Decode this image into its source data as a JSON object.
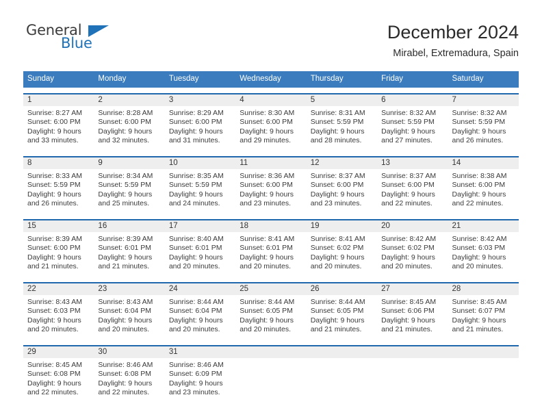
{
  "brand": {
    "word_one": "General",
    "word_two": "Blue",
    "triangle_icon": "triangle-icon",
    "color_blue": "#1f72b8",
    "color_dark": "#3b3b3b"
  },
  "header": {
    "title": "December 2024",
    "subtitle": "Mirabel, Extremadura, Spain"
  },
  "theme": {
    "header_bg": "#3a7cbe",
    "week_border": "#1f68ad",
    "day_number_bg": "#eeeeee"
  },
  "weekdays": [
    "Sunday",
    "Monday",
    "Tuesday",
    "Wednesday",
    "Thursday",
    "Friday",
    "Saturday"
  ],
  "weeks": [
    {
      "days": [
        {
          "number": "1",
          "sunrise": "Sunrise: 8:27 AM",
          "sunset": "Sunset: 6:00 PM",
          "daylight_1": "Daylight: 9 hours",
          "daylight_2": "and 33 minutes."
        },
        {
          "number": "2",
          "sunrise": "Sunrise: 8:28 AM",
          "sunset": "Sunset: 6:00 PM",
          "daylight_1": "Daylight: 9 hours",
          "daylight_2": "and 32 minutes."
        },
        {
          "number": "3",
          "sunrise": "Sunrise: 8:29 AM",
          "sunset": "Sunset: 6:00 PM",
          "daylight_1": "Daylight: 9 hours",
          "daylight_2": "and 31 minutes."
        },
        {
          "number": "4",
          "sunrise": "Sunrise: 8:30 AM",
          "sunset": "Sunset: 6:00 PM",
          "daylight_1": "Daylight: 9 hours",
          "daylight_2": "and 29 minutes."
        },
        {
          "number": "5",
          "sunrise": "Sunrise: 8:31 AM",
          "sunset": "Sunset: 5:59 PM",
          "daylight_1": "Daylight: 9 hours",
          "daylight_2": "and 28 minutes."
        },
        {
          "number": "6",
          "sunrise": "Sunrise: 8:32 AM",
          "sunset": "Sunset: 5:59 PM",
          "daylight_1": "Daylight: 9 hours",
          "daylight_2": "and 27 minutes."
        },
        {
          "number": "7",
          "sunrise": "Sunrise: 8:32 AM",
          "sunset": "Sunset: 5:59 PM",
          "daylight_1": "Daylight: 9 hours",
          "daylight_2": "and 26 minutes."
        }
      ]
    },
    {
      "days": [
        {
          "number": "8",
          "sunrise": "Sunrise: 8:33 AM",
          "sunset": "Sunset: 5:59 PM",
          "daylight_1": "Daylight: 9 hours",
          "daylight_2": "and 26 minutes."
        },
        {
          "number": "9",
          "sunrise": "Sunrise: 8:34 AM",
          "sunset": "Sunset: 5:59 PM",
          "daylight_1": "Daylight: 9 hours",
          "daylight_2": "and 25 minutes."
        },
        {
          "number": "10",
          "sunrise": "Sunrise: 8:35 AM",
          "sunset": "Sunset: 5:59 PM",
          "daylight_1": "Daylight: 9 hours",
          "daylight_2": "and 24 minutes."
        },
        {
          "number": "11",
          "sunrise": "Sunrise: 8:36 AM",
          "sunset": "Sunset: 6:00 PM",
          "daylight_1": "Daylight: 9 hours",
          "daylight_2": "and 23 minutes."
        },
        {
          "number": "12",
          "sunrise": "Sunrise: 8:37 AM",
          "sunset": "Sunset: 6:00 PM",
          "daylight_1": "Daylight: 9 hours",
          "daylight_2": "and 23 minutes."
        },
        {
          "number": "13",
          "sunrise": "Sunrise: 8:37 AM",
          "sunset": "Sunset: 6:00 PM",
          "daylight_1": "Daylight: 9 hours",
          "daylight_2": "and 22 minutes."
        },
        {
          "number": "14",
          "sunrise": "Sunrise: 8:38 AM",
          "sunset": "Sunset: 6:00 PM",
          "daylight_1": "Daylight: 9 hours",
          "daylight_2": "and 22 minutes."
        }
      ]
    },
    {
      "days": [
        {
          "number": "15",
          "sunrise": "Sunrise: 8:39 AM",
          "sunset": "Sunset: 6:00 PM",
          "daylight_1": "Daylight: 9 hours",
          "daylight_2": "and 21 minutes."
        },
        {
          "number": "16",
          "sunrise": "Sunrise: 8:39 AM",
          "sunset": "Sunset: 6:01 PM",
          "daylight_1": "Daylight: 9 hours",
          "daylight_2": "and 21 minutes."
        },
        {
          "number": "17",
          "sunrise": "Sunrise: 8:40 AM",
          "sunset": "Sunset: 6:01 PM",
          "daylight_1": "Daylight: 9 hours",
          "daylight_2": "and 20 minutes."
        },
        {
          "number": "18",
          "sunrise": "Sunrise: 8:41 AM",
          "sunset": "Sunset: 6:01 PM",
          "daylight_1": "Daylight: 9 hours",
          "daylight_2": "and 20 minutes."
        },
        {
          "number": "19",
          "sunrise": "Sunrise: 8:41 AM",
          "sunset": "Sunset: 6:02 PM",
          "daylight_1": "Daylight: 9 hours",
          "daylight_2": "and 20 minutes."
        },
        {
          "number": "20",
          "sunrise": "Sunrise: 8:42 AM",
          "sunset": "Sunset: 6:02 PM",
          "daylight_1": "Daylight: 9 hours",
          "daylight_2": "and 20 minutes."
        },
        {
          "number": "21",
          "sunrise": "Sunrise: 8:42 AM",
          "sunset": "Sunset: 6:03 PM",
          "daylight_1": "Daylight: 9 hours",
          "daylight_2": "and 20 minutes."
        }
      ]
    },
    {
      "days": [
        {
          "number": "22",
          "sunrise": "Sunrise: 8:43 AM",
          "sunset": "Sunset: 6:03 PM",
          "daylight_1": "Daylight: 9 hours",
          "daylight_2": "and 20 minutes."
        },
        {
          "number": "23",
          "sunrise": "Sunrise: 8:43 AM",
          "sunset": "Sunset: 6:04 PM",
          "daylight_1": "Daylight: 9 hours",
          "daylight_2": "and 20 minutes."
        },
        {
          "number": "24",
          "sunrise": "Sunrise: 8:44 AM",
          "sunset": "Sunset: 6:04 PM",
          "daylight_1": "Daylight: 9 hours",
          "daylight_2": "and 20 minutes."
        },
        {
          "number": "25",
          "sunrise": "Sunrise: 8:44 AM",
          "sunset": "Sunset: 6:05 PM",
          "daylight_1": "Daylight: 9 hours",
          "daylight_2": "and 20 minutes."
        },
        {
          "number": "26",
          "sunrise": "Sunrise: 8:44 AM",
          "sunset": "Sunset: 6:05 PM",
          "daylight_1": "Daylight: 9 hours",
          "daylight_2": "and 21 minutes."
        },
        {
          "number": "27",
          "sunrise": "Sunrise: 8:45 AM",
          "sunset": "Sunset: 6:06 PM",
          "daylight_1": "Daylight: 9 hours",
          "daylight_2": "and 21 minutes."
        },
        {
          "number": "28",
          "sunrise": "Sunrise: 8:45 AM",
          "sunset": "Sunset: 6:07 PM",
          "daylight_1": "Daylight: 9 hours",
          "daylight_2": "and 21 minutes."
        }
      ]
    },
    {
      "days": [
        {
          "number": "29",
          "sunrise": "Sunrise: 8:45 AM",
          "sunset": "Sunset: 6:08 PM",
          "daylight_1": "Daylight: 9 hours",
          "daylight_2": "and 22 minutes."
        },
        {
          "number": "30",
          "sunrise": "Sunrise: 8:46 AM",
          "sunset": "Sunset: 6:08 PM",
          "daylight_1": "Daylight: 9 hours",
          "daylight_2": "and 22 minutes."
        },
        {
          "number": "31",
          "sunrise": "Sunrise: 8:46 AM",
          "sunset": "Sunset: 6:09 PM",
          "daylight_1": "Daylight: 9 hours",
          "daylight_2": "and 23 minutes."
        },
        {
          "number": "",
          "sunrise": "",
          "sunset": "",
          "daylight_1": "",
          "daylight_2": ""
        },
        {
          "number": "",
          "sunrise": "",
          "sunset": "",
          "daylight_1": "",
          "daylight_2": ""
        },
        {
          "number": "",
          "sunrise": "",
          "sunset": "",
          "daylight_1": "",
          "daylight_2": ""
        },
        {
          "number": "",
          "sunrise": "",
          "sunset": "",
          "daylight_1": "",
          "daylight_2": ""
        }
      ]
    }
  ]
}
